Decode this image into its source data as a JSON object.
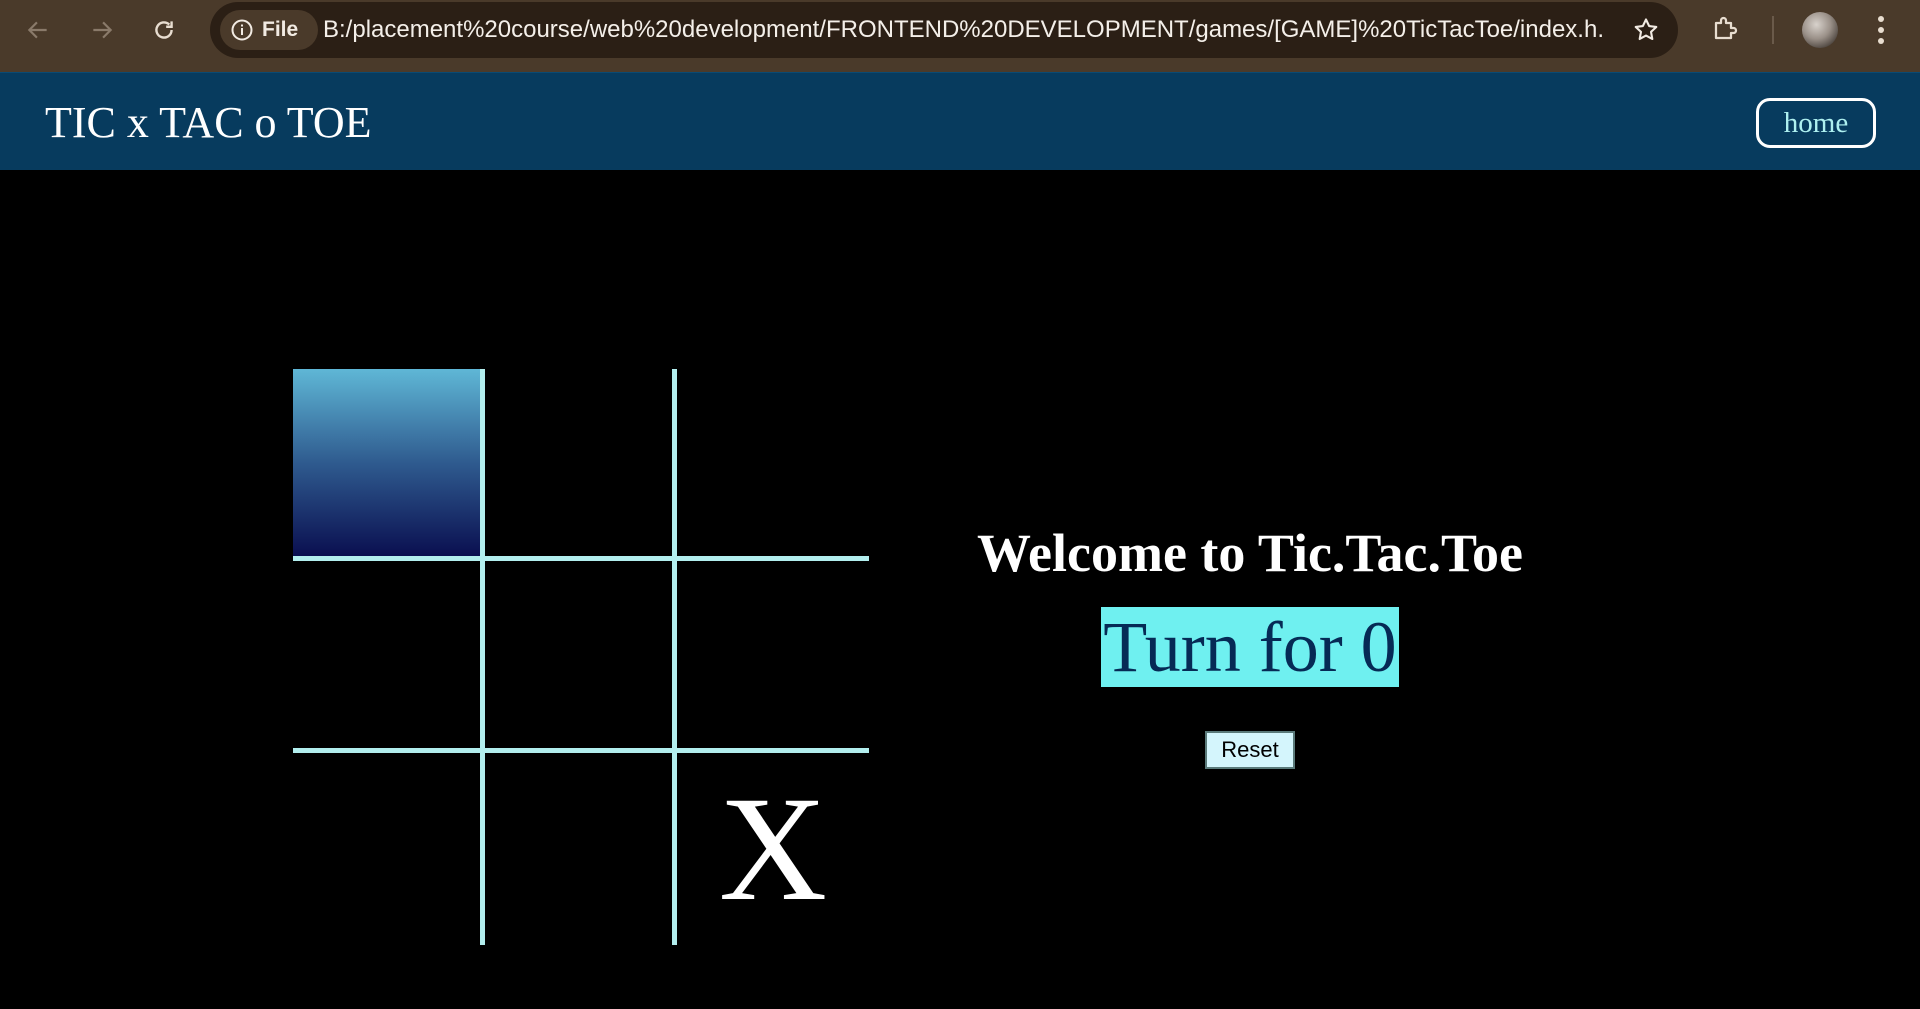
{
  "browser": {
    "site_info_label": "File",
    "url": "B:/placement%20course/web%20development/FRONTEND%20DEVELOPMENT/games/[GAME]%20TicTacToe/index.h..."
  },
  "navbar": {
    "brand": "TIC x TAC o TOE",
    "home_label": "home"
  },
  "board": {
    "cells": [
      "",
      "",
      "",
      "",
      "",
      "",
      "",
      "",
      "X"
    ],
    "highlighted_cell": 0
  },
  "info": {
    "welcome": "Welcome to Tic.Tac.Toe",
    "turn": "Turn for 0",
    "reset_label": "Reset"
  },
  "colors": {
    "navbar_bg": "#073b5e",
    "grid_line": "#b2eeee",
    "turn_bg": "#6ff0f0",
    "turn_text": "#062a55",
    "reset_bg": "#d4f5fc"
  }
}
